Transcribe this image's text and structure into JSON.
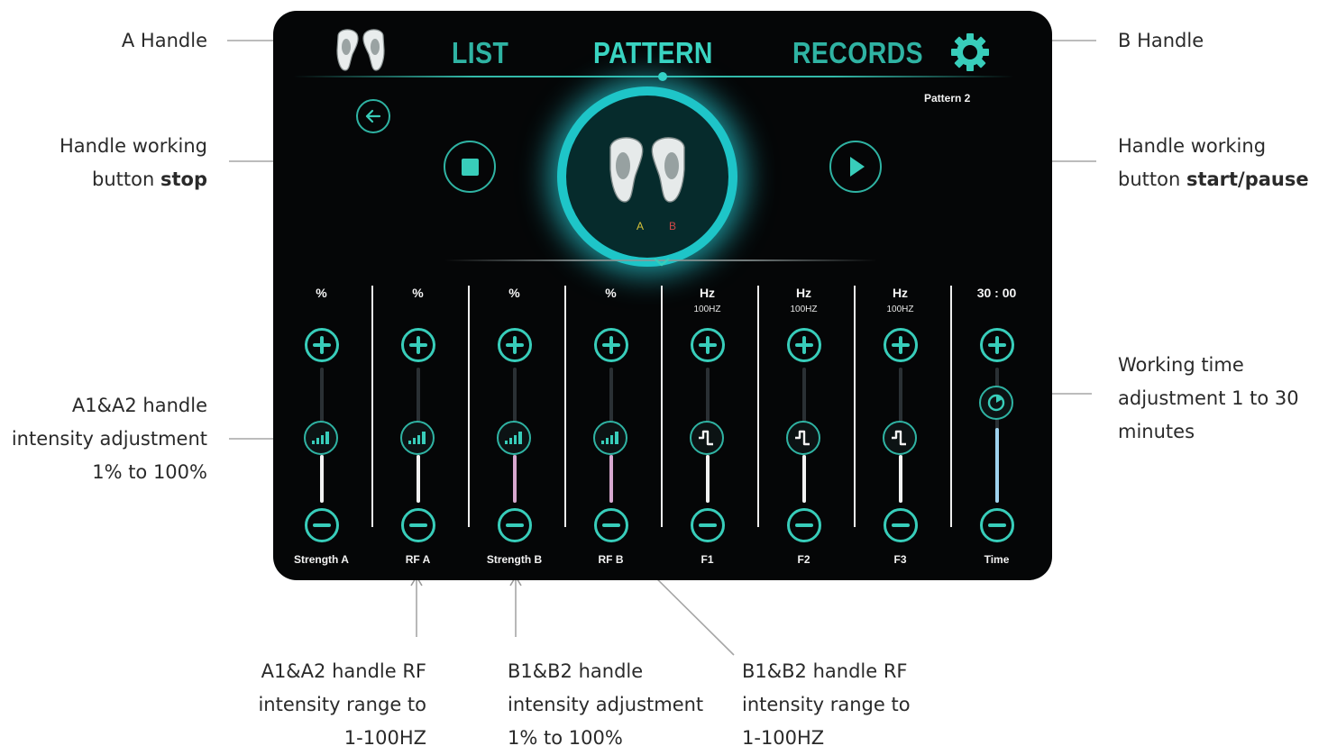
{
  "callouts": {
    "a_handle": "A Handle",
    "b_handle": "B Handle",
    "stop_line1": "Handle working",
    "stop_line2_prefix": "button ",
    "stop_line2_bold": "stop",
    "start_line1": "Handle working",
    "start_line2_prefix": "button ",
    "start_line2_bold": "start/pause",
    "a_intensity_line1": "A1&A2 handle",
    "a_intensity_line2": "intensity adjustment",
    "a_intensity_line3": "1% to 100%",
    "time_line1": "Working time",
    "time_line2": "adjustment 1 to 30",
    "time_line3": "minutes",
    "a_rf_line1": "A1&A2 handle RF",
    "a_rf_line2": "intensity range to",
    "a_rf_line3": "1-100HZ",
    "b_intensity_line1": "B1&B2 handle",
    "b_intensity_line2": "intensity adjustment",
    "b_intensity_line3": "1% to 100%",
    "b_rf_line1": "B1&B2 handle RF",
    "b_rf_line2": "intensity range to",
    "b_rf_line3": "1-100HZ"
  },
  "screen": {
    "nav": {
      "list": "LIST",
      "pattern": "PATTERN",
      "records": "RECORDS"
    },
    "pattern_label": "Pattern 2",
    "handle_a_letter": "A",
    "handle_b_letter": "B",
    "colors": {
      "accent": "#38cdba",
      "glow": "#1ec5c8",
      "background": "#050607"
    },
    "columns": [
      {
        "unit": "%",
        "subunit": "",
        "name": "Strength A",
        "icon": "signal-bars-icon",
        "level": 0.35,
        "fill": "#f2f2f2"
      },
      {
        "unit": "%",
        "subunit": "",
        "name": "RF A",
        "icon": "signal-bars-icon",
        "level": 0.35,
        "fill": "#f2f2f2"
      },
      {
        "unit": "%",
        "subunit": "",
        "name": "Strength B",
        "icon": "signal-bars-icon",
        "level": 0.35,
        "fill": "#d7a8cf"
      },
      {
        "unit": "%",
        "subunit": "",
        "name": "RF B",
        "icon": "signal-bars-icon",
        "level": 0.35,
        "fill": "#d7a8cf"
      },
      {
        "unit": "Hz",
        "subunit": "100HZ",
        "name": "F1",
        "icon": "square-wave-icon",
        "level": 0.35,
        "fill": "#f2f2f2"
      },
      {
        "unit": "Hz",
        "subunit": "100HZ",
        "name": "F2",
        "icon": "square-wave-icon",
        "level": 0.35,
        "fill": "#f2f2f2"
      },
      {
        "unit": "Hz",
        "subunit": "100HZ",
        "name": "F3",
        "icon": "square-wave-icon",
        "level": 0.35,
        "fill": "#f2f2f2"
      },
      {
        "unit": "30 : 00",
        "subunit": "",
        "name": "Time",
        "icon": "clock-icon",
        "level": 0.55,
        "fill": "#9fd3ef"
      }
    ]
  }
}
